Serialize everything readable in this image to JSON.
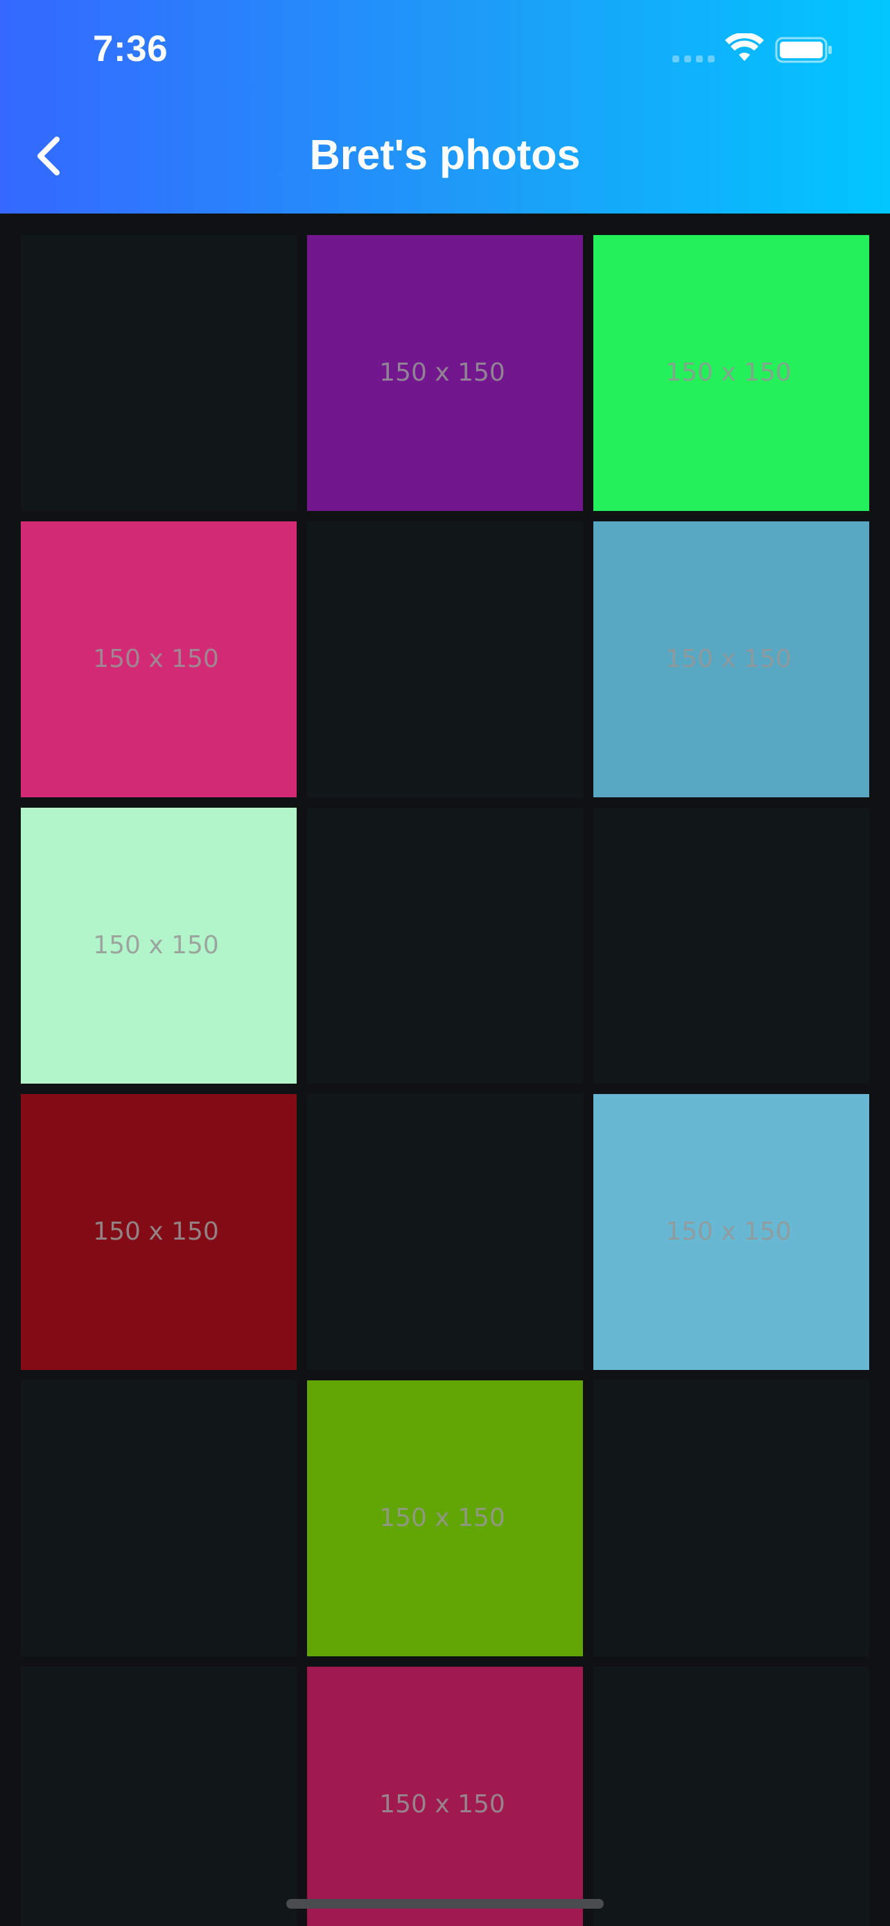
{
  "status_bar": {
    "time": "7:36",
    "icons": [
      "cellular-signal-icon",
      "wifi-icon",
      "battery-icon"
    ]
  },
  "nav_bar": {
    "back_icon": "chevron-left-icon",
    "title": "Bret's photos"
  },
  "colors": {
    "header_gradient_start": "#3468ff",
    "header_gradient_end": "#01c6ff",
    "background": "#101112",
    "empty_tile": "#111619"
  },
  "photos": [
    {
      "label": "",
      "color": "#111619"
    },
    {
      "label": "150 x 150",
      "color": "#73178f"
    },
    {
      "label": "150 x 150",
      "color": "#24f05a"
    },
    {
      "label": "150 x 150",
      "color": "#d32a76"
    },
    {
      "label": "",
      "color": "#111619"
    },
    {
      "label": "150 x 150",
      "color": "#58a8c3"
    },
    {
      "label": "150 x 150",
      "color": "#b3f5cb"
    },
    {
      "label": "",
      "color": "#111619"
    },
    {
      "label": "",
      "color": "#111619"
    },
    {
      "label": "150 x 150",
      "color": "#820b15"
    },
    {
      "label": "",
      "color": "#111619"
    },
    {
      "label": "150 x 150",
      "color": "#69b8d3"
    },
    {
      "label": "",
      "color": "#111619"
    },
    {
      "label": "150 x 150",
      "color": "#61a604"
    },
    {
      "label": "",
      "color": "#111619"
    },
    {
      "label": "",
      "color": "#111619"
    },
    {
      "label": "150 x 150",
      "color": "#a0194f"
    },
    {
      "label": "",
      "color": "#111619"
    }
  ]
}
